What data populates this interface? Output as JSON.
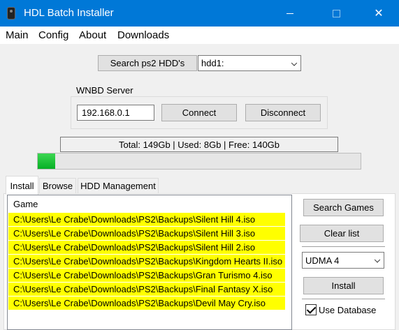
{
  "window": {
    "title": "HDL Batch Installer",
    "controls": {
      "minimize": "minimize",
      "maximize": "maximize",
      "close": "✕"
    }
  },
  "menu": [
    "Main",
    "Config",
    "About",
    "Downloads"
  ],
  "toolbar": {
    "search_hdd_label": "Search ps2 HDD's",
    "hdd_select_value": "hdd1:"
  },
  "wnbd": {
    "label": "WNBD Server",
    "ip_value": "192.168.0.1",
    "connect_label": "Connect",
    "disconnect_label": "Disconnect"
  },
  "status": {
    "text": "Total: 149Gb | Used: 8Gb | Free: 140Gb",
    "progress_fraction": 0.054,
    "progress_color": "#06b025"
  },
  "tabs": [
    {
      "label": "Install",
      "active": true
    },
    {
      "label": "Browse",
      "active": false
    },
    {
      "label": "HDD Management",
      "active": false
    }
  ],
  "list": {
    "header": "Game",
    "highlight_color": "#ffff00",
    "rows": [
      "C:\\Users\\Le Crabe\\Downloads\\PS2\\Backups\\Silent Hill 4.iso",
      "C:\\Users\\Le Crabe\\Downloads\\PS2\\Backups\\Silent Hill 3.iso",
      "C:\\Users\\Le Crabe\\Downloads\\PS2\\Backups\\Silent Hill 2.iso",
      "C:\\Users\\Le Crabe\\Downloads\\PS2\\Backups\\Kingdom Hearts II.iso",
      "C:\\Users\\Le Crabe\\Downloads\\PS2\\Backups\\Gran Turismo 4.iso",
      "C:\\Users\\Le Crabe\\Downloads\\PS2\\Backups\\Final Fantasy X.iso",
      "C:\\Users\\Le Crabe\\Downloads\\PS2\\Backups\\Devil May Cry.iso"
    ]
  },
  "side": {
    "search_games_label": "Search Games",
    "clear_list_label": "Clear list",
    "mode_select_value": "UDMA 4",
    "install_label": "Install",
    "use_database_label": "Use Database",
    "use_database_checked": true
  },
  "colors": {
    "titlebar": "#0078d7",
    "accent": "#0078d7"
  }
}
